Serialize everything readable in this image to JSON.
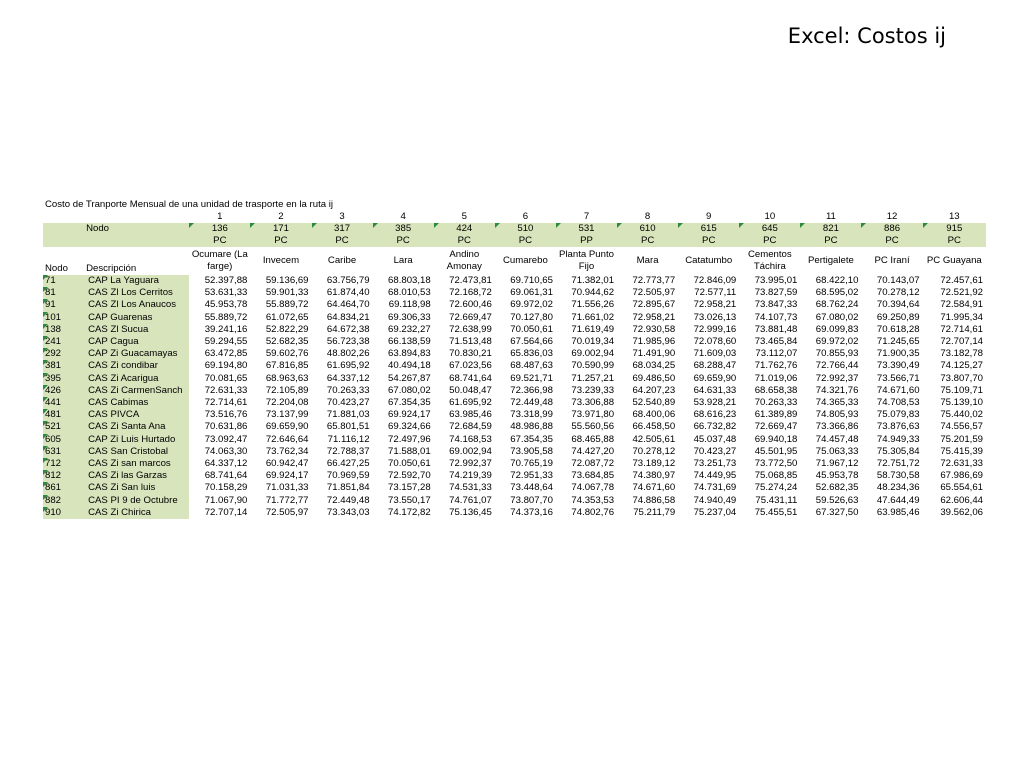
{
  "slide": {
    "title": "Excel: Costos ij"
  },
  "table": {
    "caption": "Costo de Tranporte Mensual de una unidad de trasporte en la ruta ij",
    "col_indices": [
      "1",
      "2",
      "3",
      "4",
      "5",
      "6",
      "7",
      "8",
      "9",
      "10",
      "11",
      "12",
      "13"
    ],
    "nodo_label": "Nodo",
    "nodo_codes": [
      "136",
      "171",
      "317",
      "385",
      "424",
      "510",
      "531",
      "610",
      "615",
      "645",
      "821",
      "886",
      "915"
    ],
    "nodo_types": [
      "PC",
      "PC",
      "PC",
      "PC",
      "PC",
      "PC",
      "PP",
      "PC",
      "PC",
      "PC",
      "PC",
      "PC",
      "PC"
    ],
    "row_header_nodo": "Nodo",
    "row_header_desc": "Descripción",
    "dest_names": [
      "Ocumare (La farge)",
      "Invecem",
      "Caribe",
      "Lara",
      "Andino Amonay",
      "Cumarebo",
      "Planta Punto Fijo",
      "Mara",
      "Catatumbo",
      "Cementos Táchira",
      "Pertigalete",
      "PC Iraní",
      "PC Guayana"
    ],
    "rows": [
      {
        "nodo": "71",
        "desc": "CAP La Yaguara",
        "values": [
          "52.397,88",
          "59.136,69",
          "63.756,79",
          "68.803,18",
          "72.473,81",
          "69.710,65",
          "71.382,01",
          "72.773,77",
          "72.846,09",
          "73.995,01",
          "68.422,10",
          "70.143,07",
          "72.457,61"
        ]
      },
      {
        "nodo": "81",
        "desc": "CAS Zl Los Cerritos",
        "values": [
          "53.631,33",
          "59.901,33",
          "61.874,40",
          "68.010,53",
          "72.168,72",
          "69.061,31",
          "70.944,62",
          "72.505,97",
          "72.577,11",
          "73.827,59",
          "68.595,02",
          "70.278,12",
          "72.521,92"
        ]
      },
      {
        "nodo": "91",
        "desc": "CAS Zl Los Anaucos",
        "values": [
          "45.953,78",
          "55.889,72",
          "64.464,70",
          "69.118,98",
          "72.600,46",
          "69.972,02",
          "71.556,26",
          "72.895,67",
          "72.958,21",
          "73.847,33",
          "68.762,24",
          "70.394,64",
          "72.584,91"
        ]
      },
      {
        "nodo": "101",
        "desc": "CAP Guarenas",
        "values": [
          "55.889,72",
          "61.072,65",
          "64.834,21",
          "69.306,33",
          "72.669,47",
          "70.127,80",
          "71.661,02",
          "72.958,21",
          "73.026,13",
          "74.107,73",
          "67.080,02",
          "69.250,89",
          "71.995,34"
        ]
      },
      {
        "nodo": "138",
        "desc": "CAS Zl Sucua",
        "values": [
          "39.241,16",
          "52.822,29",
          "64.672,38",
          "69.232,27",
          "72.638,99",
          "70.050,61",
          "71.619,49",
          "72.930,58",
          "72.999,16",
          "73.881,48",
          "69.099,83",
          "70.618,28",
          "72.714,61"
        ]
      },
      {
        "nodo": "241",
        "desc": "CAP Cagua",
        "values": [
          "59.294,55",
          "52.682,35",
          "56.723,38",
          "66.138,59",
          "71.513,48",
          "67.564,66",
          "70.019,34",
          "71.985,96",
          "72.078,60",
          "73.465,84",
          "69.972,02",
          "71.245,65",
          "72.707,14"
        ]
      },
      {
        "nodo": "292",
        "desc": "CAP Zi Guacamayas",
        "values": [
          "63.472,85",
          "59.602,76",
          "48.802,26",
          "63.894,83",
          "70.830,21",
          "65.836,03",
          "69.002,94",
          "71.491,90",
          "71.609,03",
          "73.112,07",
          "70.855,93",
          "71.900,35",
          "73.182,78"
        ]
      },
      {
        "nodo": "381",
        "desc": "CAS Zi condibar",
        "values": [
          "69.194,80",
          "67.816,85",
          "61.695,92",
          "40.494,18",
          "67.023,56",
          "68.487,63",
          "70.590,99",
          "68.034,25",
          "68.288,47",
          "71.762,76",
          "72.766,44",
          "73.390,49",
          "74.125,27"
        ]
      },
      {
        "nodo": "395",
        "desc": "CAS Zi Acarigua",
        "values": [
          "70.081,65",
          "68.963,63",
          "64.337,12",
          "54.267,87",
          "68.741,64",
          "69.521,71",
          "71.257,21",
          "69.486,50",
          "69.659,90",
          "71.019,06",
          "72.992,37",
          "73.566,71",
          "73.807,70"
        ]
      },
      {
        "nodo": "426",
        "desc": "CAS Zi CarmenSanch",
        "values": [
          "72.631,33",
          "72.105,89",
          "70.263,33",
          "67.080,02",
          "50.048,47",
          "72.366,98",
          "73.239,33",
          "64.207,23",
          "64.631,33",
          "68.658,38",
          "74.321,76",
          "74.671,60",
          "75.109,71"
        ]
      },
      {
        "nodo": "441",
        "desc": "CAS Cabimas",
        "values": [
          "72.714,61",
          "72.204,08",
          "70.423,27",
          "67.354,35",
          "61.695,92",
          "72.449,48",
          "73.306,88",
          "52.540,89",
          "53.928,21",
          "70.263,33",
          "74.365,33",
          "74.708,53",
          "75.139,10"
        ]
      },
      {
        "nodo": "481",
        "desc": "CAS PIVCA",
        "values": [
          "73.516,76",
          "73.137,99",
          "71.881,03",
          "69.924,17",
          "63.985,46",
          "73.318,99",
          "73.971,80",
          "68.400,06",
          "68.616,23",
          "61.389,89",
          "74.805,93",
          "75.079,83",
          "75.440,02"
        ]
      },
      {
        "nodo": "521",
        "desc": "CAS Zi Santa Ana",
        "values": [
          "70.631,86",
          "69.659,90",
          "65.801,51",
          "69.324,66",
          "72.684,59",
          "48.986,88",
          "55.560,56",
          "66.458,50",
          "66.732,82",
          "72.669,47",
          "73.366,86",
          "73.876,63",
          "74.556,57"
        ]
      },
      {
        "nodo": "605",
        "desc": "CAP Zi Luis Hurtado",
        "values": [
          "73.092,47",
          "72.646,64",
          "71.116,12",
          "72.497,96",
          "74.168,53",
          "67.354,35",
          "68.465,88",
          "42.505,61",
          "45.037,48",
          "69.940,18",
          "74.457,48",
          "74.949,33",
          "75.201,59"
        ]
      },
      {
        "nodo": "631",
        "desc": "CAS San Cristobal",
        "values": [
          "74.063,30",
          "73.762,34",
          "72.788,37",
          "71.588,01",
          "69.002,94",
          "73.905,58",
          "74.427,20",
          "70.278,12",
          "70.423,27",
          "45.501,95",
          "75.063,33",
          "75.305,84",
          "75.415,39"
        ]
      },
      {
        "nodo": "712",
        "desc": "CAS Zi san marcos",
        "values": [
          "64.337,12",
          "60.942,47",
          "66.427,25",
          "70.050,61",
          "72.992,37",
          "70.765,19",
          "72.087,72",
          "73.189,12",
          "73.251,73",
          "73.772,50",
          "71.967,12",
          "72.751,72",
          "72.631,33"
        ]
      },
      {
        "nodo": "812",
        "desc": "CAS Zi las Garzas",
        "values": [
          "68.741,64",
          "69.924,17",
          "70.969,59",
          "72.592,70",
          "74.219,39",
          "72.951,33",
          "73.684,85",
          "74.380,97",
          "74.449,95",
          "75.068,85",
          "45.953,78",
          "58.730,58",
          "67.986,69"
        ]
      },
      {
        "nodo": "861",
        "desc": "CAS Zi San luis",
        "values": [
          "70.158,29",
          "71.031,33",
          "71.851,84",
          "73.157,28",
          "74.531,33",
          "73.448,64",
          "74.067,78",
          "74.671,60",
          "74.731,69",
          "75.274,24",
          "52.682,35",
          "48.234,36",
          "65.554,61"
        ]
      },
      {
        "nodo": "882",
        "desc": "CAS PI 9 de Octubre",
        "values": [
          "71.067,90",
          "71.772,77",
          "72.449,48",
          "73.550,17",
          "74.761,07",
          "73.807,70",
          "74.353,53",
          "74.886,58",
          "74.940,49",
          "75.431,11",
          "59.526,63",
          "47.644,49",
          "62.606,44"
        ]
      },
      {
        "nodo": "910",
        "desc": "CAS Zi Chirica",
        "values": [
          "72.707,14",
          "72.505,97",
          "73.343,03",
          "74.172,82",
          "75.136,45",
          "74.373,16",
          "74.802,76",
          "75.211,79",
          "75.237,04",
          "75.455,51",
          "67.327,50",
          "63.985,46",
          "39.562,06"
        ]
      }
    ]
  }
}
